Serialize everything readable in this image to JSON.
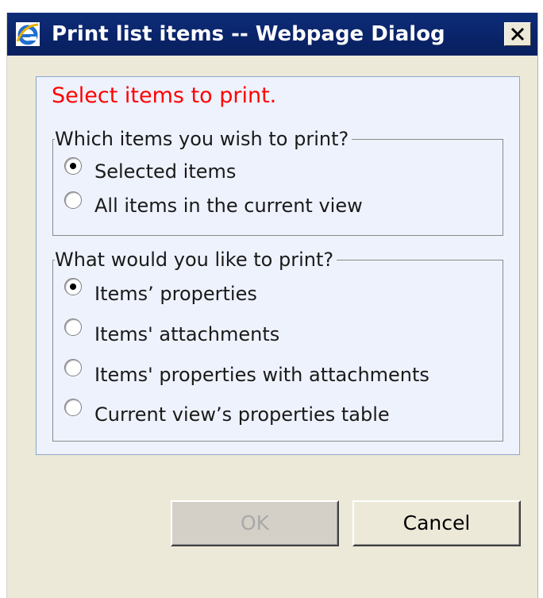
{
  "window": {
    "title": "Print list items -- Webpage Dialog",
    "icons": {
      "app": "ie-icon",
      "close": "close-icon"
    }
  },
  "panel": {
    "headline": "Select items to print.",
    "headline_color": "#ff0000",
    "scope_group": {
      "legend": "Which items you wish to print?",
      "options": [
        {
          "label": "Selected items",
          "selected": true
        },
        {
          "label": "All items in the current view",
          "selected": false
        }
      ]
    },
    "content_group": {
      "legend": "What would you like to print?",
      "options": [
        {
          "label": "Items’ properties",
          "selected": true
        },
        {
          "label": "Items' attachments",
          "selected": false
        },
        {
          "label": "Items' properties with attachments",
          "selected": false
        },
        {
          "label": "Current view’s properties table",
          "selected": false
        }
      ]
    }
  },
  "buttons": {
    "ok": {
      "label": "OK",
      "enabled": false
    },
    "cancel": {
      "label": "Cancel",
      "enabled": true
    }
  }
}
